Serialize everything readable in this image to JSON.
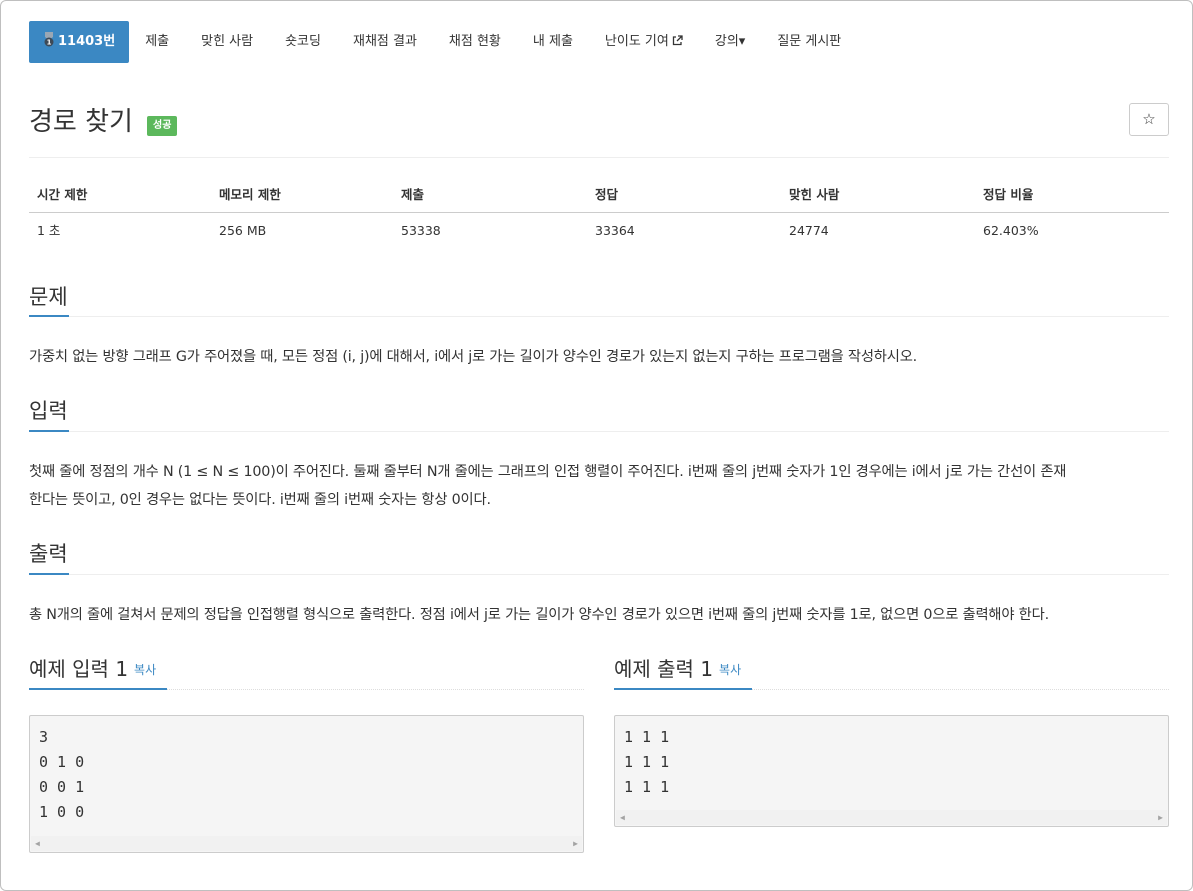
{
  "nav": {
    "problem_number": "11403번",
    "items": [
      "제출",
      "맞힌 사람",
      "숏코딩",
      "재채점 결과",
      "채점 현황",
      "내 제출",
      "난이도 기여",
      "강의▾",
      "질문 게시판"
    ]
  },
  "problem": {
    "title": "경로 찾기",
    "status_badge": "성공",
    "star": "☆"
  },
  "info_table": {
    "headers": [
      "시간 제한",
      "메모리 제한",
      "제출",
      "정답",
      "맞힌 사람",
      "정답 비율"
    ],
    "values": [
      "1 초",
      "256 MB",
      "53338",
      "33364",
      "24774",
      "62.403%"
    ]
  },
  "sections": {
    "description": {
      "heading": "문제",
      "text": "가중치 없는 방향 그래프 G가 주어졌을 때, 모든 정점 (i, j)에 대해서, i에서 j로 가는 길이가 양수인 경로가 있는지 없는지 구하는 프로그램을 작성하시오."
    },
    "input": {
      "heading": "입력",
      "lines": [
        "첫째 줄에 정점의 개수 N (1 ≤ N ≤ 100)이 주어진다. 둘째 줄부터 N개 줄에는 그래프의 인접 행렬이 주어진다. i번째 줄의 j번째 숫자가 1인 경우에는 i에서 j로 가는 간선이 존재",
        "한다는 뜻이고, 0인 경우는 없다는 뜻이다. i번째 줄의 i번째 숫자는 항상 0이다."
      ]
    },
    "output": {
      "heading": "출력",
      "text": "총 N개의 줄에 걸쳐서 문제의 정답을 인접행렬 형식으로 출력한다. 정점 i에서 j로 가는 길이가 양수인 경로가 있으면 i번째 줄의 j번째 숫자를 1로, 없으면 0으로 출력해야 한다."
    }
  },
  "examples": {
    "copy_label": "복사",
    "input": {
      "heading": "예제 입력 1",
      "lines": [
        "3",
        "0 1 0",
        "0 0 1",
        "1 0 0"
      ]
    },
    "output": {
      "heading": "예제 출력 1",
      "lines": [
        "1 1 1",
        "1 1 1",
        "1 1 1"
      ]
    }
  },
  "colors": {
    "accent": "#3b88c3",
    "success": "#5cb85c"
  },
  "icons": [
    "medal-icon",
    "external-link-icon",
    "caret-down-icon",
    "star-icon",
    "scroll-left-icon",
    "scroll-right-icon"
  ]
}
